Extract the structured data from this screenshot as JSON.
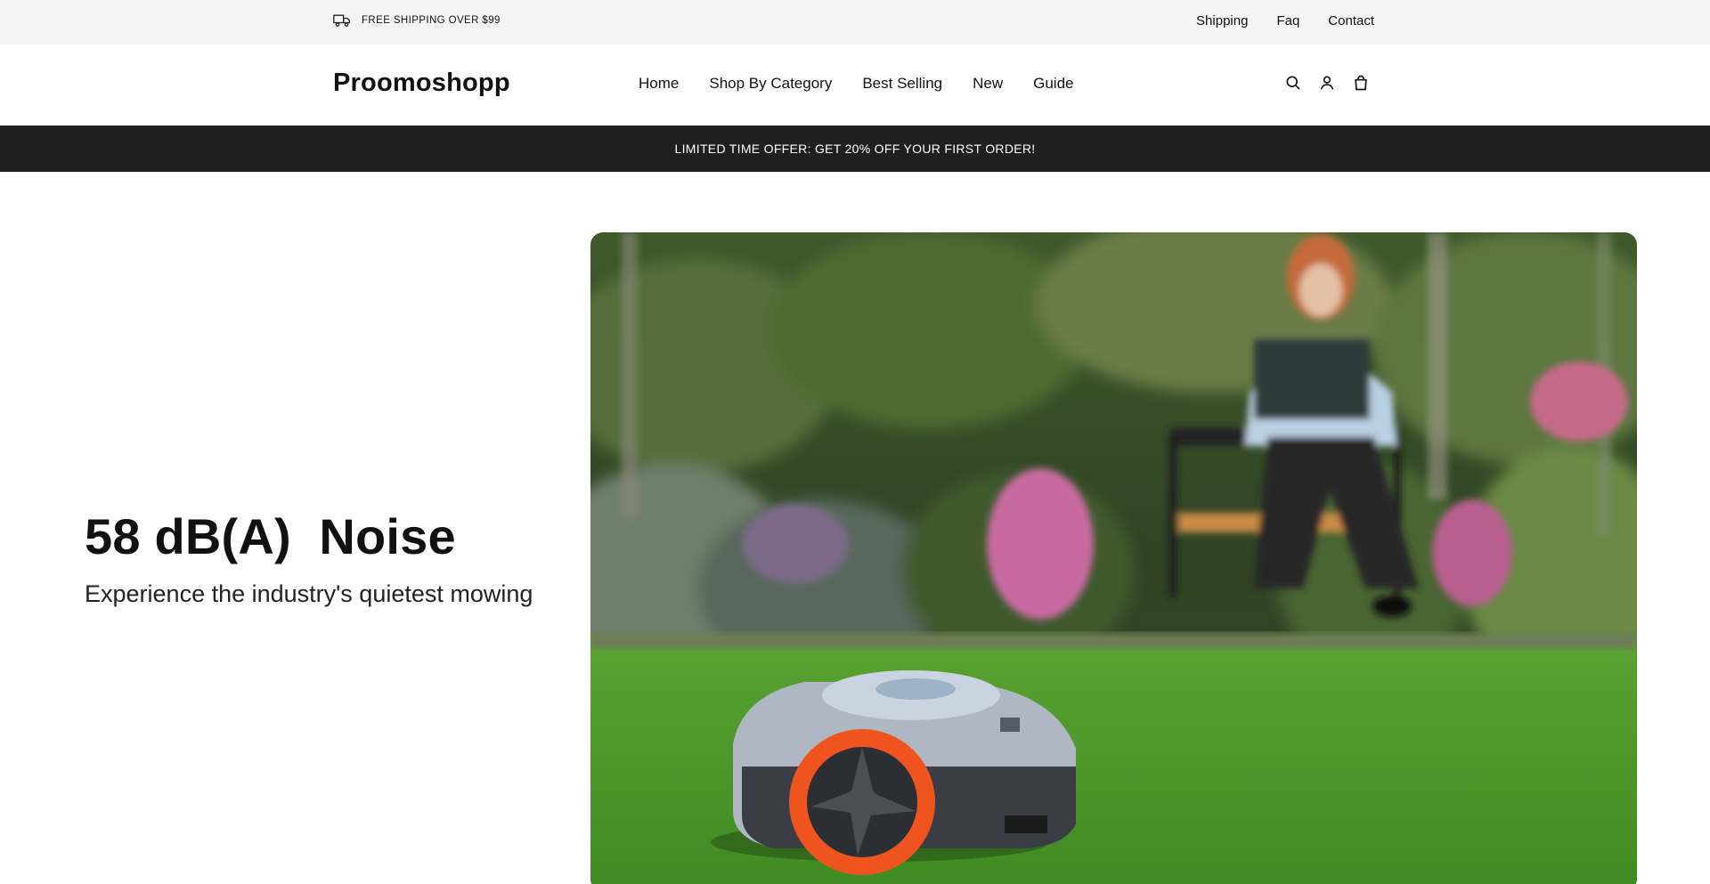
{
  "topbar": {
    "shipping_icon": "truck-icon",
    "shipping_text": "FREE SHIPPING OVER $99",
    "links": [
      "Shipping",
      "Faq",
      "Contact"
    ]
  },
  "header": {
    "logo": "Proomoshopp",
    "nav": [
      "Home",
      "Shop By Category",
      "Best Selling",
      "New",
      "Guide"
    ],
    "icons": [
      "search-icon",
      "account-icon",
      "cart-bag-icon"
    ]
  },
  "promo": {
    "text": "LIMITED TIME OFFER: GET 20% OFF YOUR FIRST ORDER!"
  },
  "hero": {
    "title": "58 dB(A)  Noise",
    "subtitle": "Experience the industry's quietest mowing",
    "image": "robotic-lawn-mower-garden-photo"
  },
  "colors": {
    "topbar_bg": "#f5f5f5",
    "promo_bg": "#1f1f1f",
    "text": "#111111",
    "mower_accent": "#f0541e"
  }
}
